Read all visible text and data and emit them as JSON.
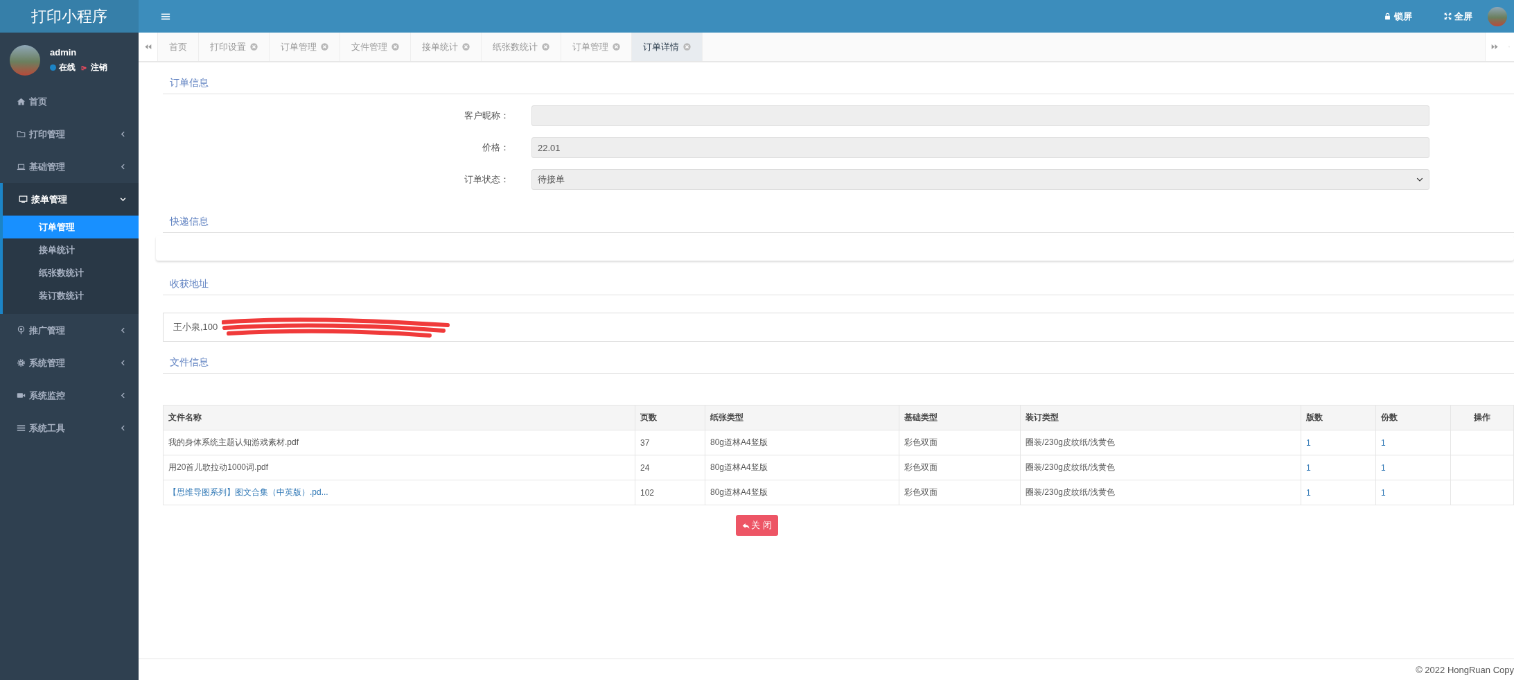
{
  "app_title": "打印小程序",
  "user": {
    "name": "admin",
    "status": "在线",
    "logout": "注销"
  },
  "sidebar": {
    "items": [
      {
        "label": "首页",
        "expandable": false,
        "expanded": false
      },
      {
        "label": "打印管理",
        "expandable": true,
        "expanded": false
      },
      {
        "label": "基础管理",
        "expandable": true,
        "expanded": false
      },
      {
        "label": "接单管理",
        "expandable": true,
        "expanded": true,
        "children": [
          {
            "label": "订单管理",
            "selected": true
          },
          {
            "label": "接单统计",
            "selected": false
          },
          {
            "label": "纸张数统计",
            "selected": false
          },
          {
            "label": "装订数统计",
            "selected": false
          }
        ]
      },
      {
        "label": "推广管理",
        "expandable": true,
        "expanded": false
      },
      {
        "label": "系统管理",
        "expandable": true,
        "expanded": false
      },
      {
        "label": "系统监控",
        "expandable": true,
        "expanded": false
      },
      {
        "label": "系统工具",
        "expandable": true,
        "expanded": false
      }
    ]
  },
  "header": {
    "actions": [
      {
        "label": "锁屏"
      },
      {
        "label": "全屏"
      }
    ]
  },
  "tabs": [
    {
      "label": "首页",
      "closable": false,
      "selected": false
    },
    {
      "label": "打印设置",
      "closable": true,
      "selected": false
    },
    {
      "label": "订单管理",
      "closable": true,
      "selected": false
    },
    {
      "label": "文件管理",
      "closable": true,
      "selected": false
    },
    {
      "label": "接单统计",
      "closable": true,
      "selected": false
    },
    {
      "label": "纸张数统计",
      "closable": true,
      "selected": false
    },
    {
      "label": "订单管理",
      "closable": true,
      "selected": false
    },
    {
      "label": "订单详情",
      "closable": true,
      "selected": true
    }
  ],
  "order_info": {
    "title": "订单信息",
    "fields": [
      {
        "kind": "input",
        "label": "客户昵称："
      },
      {
        "kind": "input",
        "label": "价格：",
        "value": "22.01"
      },
      {
        "kind": "select",
        "label": "订单状态：",
        "value": "待接单"
      }
    ]
  },
  "express_info": {
    "title": "快递信息"
  },
  "address": {
    "title": "收获地址",
    "value": "王小泉,100"
  },
  "file_info": {
    "title": "文件信息",
    "table": {
      "columns": [
        "文件名称",
        "页数",
        "纸张类型",
        "基础类型",
        "装订类型",
        "版数",
        "份数",
        "操作"
      ],
      "rows": [
        {
          "link": false,
          "cells": [
            "我的身体系统主题认知游戏素材.pdf",
            "37",
            "80g道林A4竖版",
            "彩色双面",
            "圈装/230g皮纹纸/浅黄色",
            "1",
            "1"
          ]
        },
        {
          "link": false,
          "cells": [
            "用20首儿歌拉动1000词.pdf",
            "24",
            "80g道林A4竖版",
            "彩色双面",
            "圈装/230g皮纹纸/浅黄色",
            "1",
            "1"
          ]
        },
        {
          "link": true,
          "cells": [
            "【思维导图系列】图文合集（中英版）.pd...",
            "102",
            "80g道林A4竖版",
            "彩色双面",
            "圈装/230g皮纹纸/浅黄色",
            "1",
            "1"
          ]
        }
      ]
    }
  },
  "close_button": "关 闭",
  "footer": "© 2022 HongRuan Copy"
}
